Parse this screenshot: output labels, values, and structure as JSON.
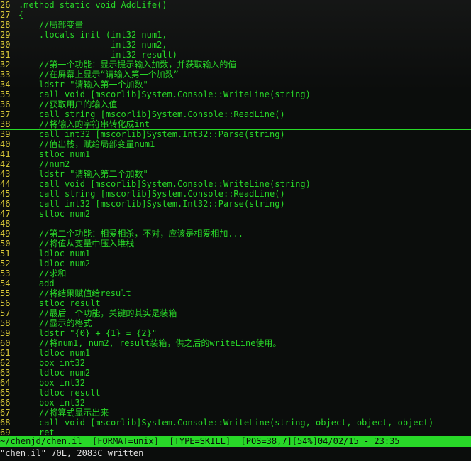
{
  "colors": {
    "code": "#28d828",
    "line_number": "#d8c838",
    "status_bg": "#28d828",
    "background": "#0b0d0c"
  },
  "lines": [
    {
      "n": "26",
      "t": ".method static void AddLife()"
    },
    {
      "n": "27",
      "t": "{"
    },
    {
      "n": "28",
      "t": "    //局部变量"
    },
    {
      "n": "29",
      "t": "    .locals init (int32 num1,"
    },
    {
      "n": "30",
      "t": "                  int32 num2,"
    },
    {
      "n": "31",
      "t": "                  int32 result)"
    },
    {
      "n": "32",
      "t": "    //第一个功能：显示提示输入加数，并获取输入的值"
    },
    {
      "n": "33",
      "t": "    //在屏幕上显示“请输入第一个加数”"
    },
    {
      "n": "34",
      "t": "    ldstr \"请输入第一个加数\""
    },
    {
      "n": "35",
      "t": "    call void [mscorlib]System.Console::WriteLine(string)"
    },
    {
      "n": "36",
      "t": "    //获取用户的输入值"
    },
    {
      "n": "37",
      "t": "    call string [mscorlib]System.Console::ReadLine()"
    },
    {
      "n": "38",
      "t": "    //将输入的字符串转化成int"
    },
    {
      "n": "39",
      "t": "    call int32 [mscorlib]System.Int32::Parse(string)"
    },
    {
      "n": "40",
      "t": "    //值出栈，赋给局部变量num1"
    },
    {
      "n": "41",
      "t": "    stloc num1"
    },
    {
      "n": "42",
      "t": "    //num2"
    },
    {
      "n": "43",
      "t": "    ldstr \"请输入第二个加数\""
    },
    {
      "n": "44",
      "t": "    call void [mscorlib]System.Console::WriteLine(string)"
    },
    {
      "n": "45",
      "t": "    call string [mscorlib]System.Console::ReadLine()"
    },
    {
      "n": "46",
      "t": "    call int32 [mscorlib]System.Int32::Parse(string)"
    },
    {
      "n": "47",
      "t": "    stloc num2"
    },
    {
      "n": "48",
      "t": ""
    },
    {
      "n": "49",
      "t": "    //第二个功能：相爱相杀，不对，应该是相爱相加..."
    },
    {
      "n": "50",
      "t": "    //将值从变量中压入堆栈"
    },
    {
      "n": "51",
      "t": "    ldloc num1"
    },
    {
      "n": "52",
      "t": "    ldloc num2"
    },
    {
      "n": "53",
      "t": "    //求和"
    },
    {
      "n": "54",
      "t": "    add"
    },
    {
      "n": "55",
      "t": "    //将结果赋值给result"
    },
    {
      "n": "56",
      "t": "    stloc result"
    },
    {
      "n": "57",
      "t": "    //最后一个功能，关键的其实是装箱"
    },
    {
      "n": "58",
      "t": "    //显示的格式"
    },
    {
      "n": "59",
      "t": "    ldstr \"{0} + {1} = {2}\""
    },
    {
      "n": "60",
      "t": "    //将num1, num2, result装箱，供之后的writeLine使用。"
    },
    {
      "n": "61",
      "t": "    ldloc num1"
    },
    {
      "n": "62",
      "t": "    box int32"
    },
    {
      "n": "63",
      "t": "    ldloc num2"
    },
    {
      "n": "64",
      "t": "    box int32"
    },
    {
      "n": "65",
      "t": "    ldloc result"
    },
    {
      "n": "66",
      "t": "    box int32"
    },
    {
      "n": "67",
      "t": "    //将算式显示出来"
    },
    {
      "n": "68",
      "t": "    call void [mscorlib]System.Console::WriteLine(string, object, object, object)"
    },
    {
      "n": "69",
      "t": "    ret"
    }
  ],
  "status_line": "~/chenjd/chen.il  [FORMAT=unix]  [TYPE=SKILL]  [POS=38,7][54%]04/02/15 - 23:35",
  "message_line": "\"chen.il\" 70L, 2083C written"
}
